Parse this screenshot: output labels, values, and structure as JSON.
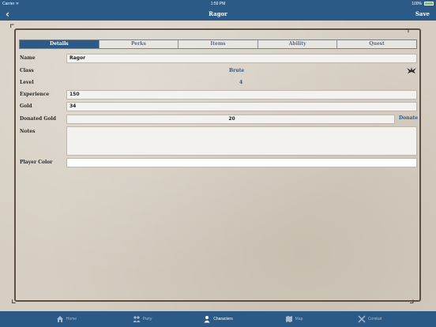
{
  "status_bar": {
    "carrier": "Carrier ᯤ",
    "time": "1:59 PM",
    "battery": "100%"
  },
  "nav": {
    "back_icon": "chevron-left-icon",
    "title": "Ragor",
    "save_label": "Save"
  },
  "tabs": [
    {
      "label": "Details",
      "active": true
    },
    {
      "label": "Perks",
      "active": false
    },
    {
      "label": "Items",
      "active": false
    },
    {
      "label": "Ability",
      "active": false
    },
    {
      "label": "Quest",
      "active": false
    }
  ],
  "details": {
    "name_label": "Name",
    "name_value": "Ragor",
    "class_label": "Class",
    "class_value": "Brute",
    "level_label": "Level",
    "level_value": "4",
    "experience_label": "Experience",
    "experience_value": "150",
    "gold_label": "Gold",
    "gold_value": "34",
    "donated_gold_label": "Donated Gold",
    "donated_gold_value": "20",
    "donate_label": "Donate",
    "notes_label": "Notes",
    "notes_value": "",
    "player_color_label": "Player Color",
    "player_color_value": ""
  },
  "bottom_tabs": [
    {
      "label": "Home",
      "icon": "home-icon",
      "active": false
    },
    {
      "label": "Party",
      "icon": "party-icon",
      "active": false
    },
    {
      "label": "Characters",
      "icon": "person-icon",
      "active": true
    },
    {
      "label": "Map",
      "icon": "map-icon",
      "active": false
    },
    {
      "label": "Combat",
      "icon": "crossed-swords-icon",
      "active": false
    }
  ],
  "colors": {
    "accent": "#2c5a86",
    "parchment": "#d6cec2"
  }
}
